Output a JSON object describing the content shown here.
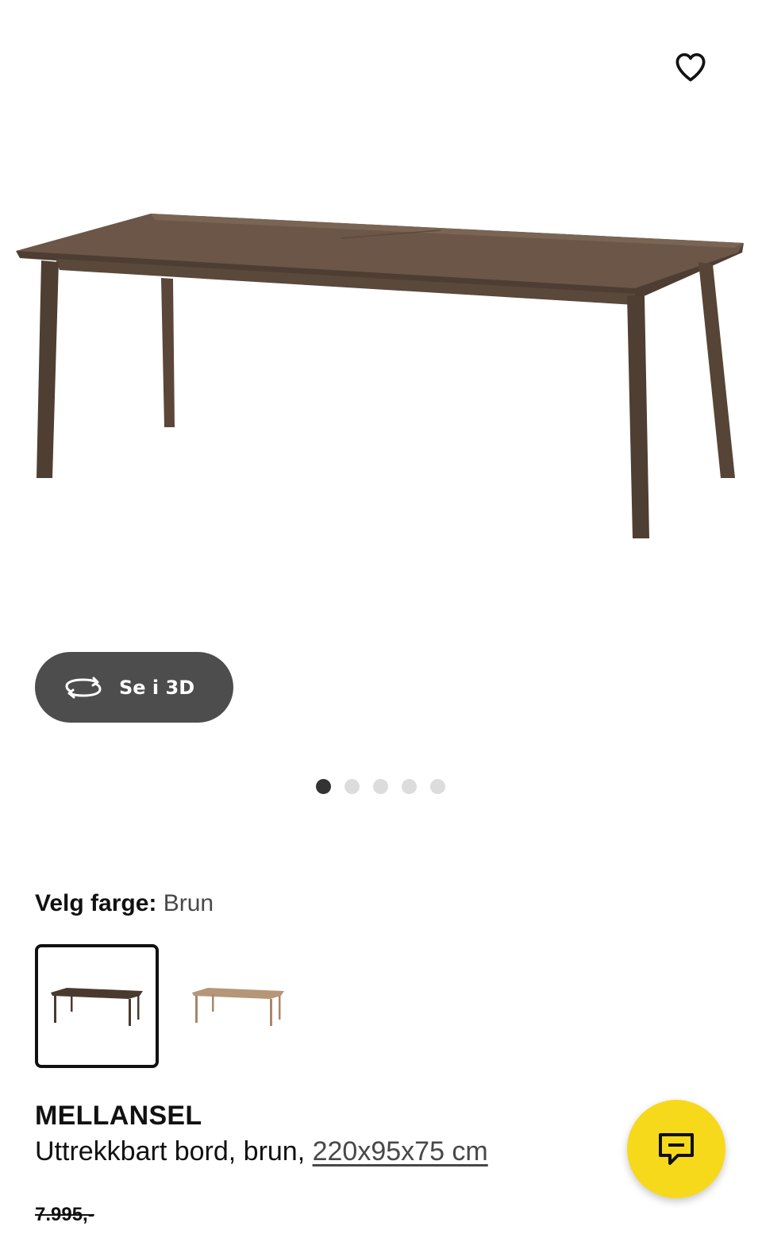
{
  "gallery": {
    "favorite_icon": "heart-outline-icon",
    "image_alt": "MELLANSEL uttrekkbart bord, brun",
    "view3d": {
      "icon": "rotate-3d-icon",
      "label": "Se i 3D"
    },
    "dots": {
      "count": 5,
      "active_index": 0
    }
  },
  "color_picker": {
    "label": "Velg farge:",
    "selected_value": "Brun",
    "options": [
      {
        "color": "#4a3a2e",
        "selected": true
      },
      {
        "color": "#b59679",
        "selected": false
      }
    ]
  },
  "product": {
    "name": "MELLANSEL",
    "description": "Uttrekkbart bord, brun,",
    "dimensions": "220x95x75 cm",
    "old_price": "7.995,-"
  },
  "chat": {
    "icon": "chat-bubble-icon"
  },
  "colors": {
    "accent_yellow": "#f7d91c",
    "button_dark": "#4d4d4d",
    "table_wood": "#5e4b3e"
  }
}
